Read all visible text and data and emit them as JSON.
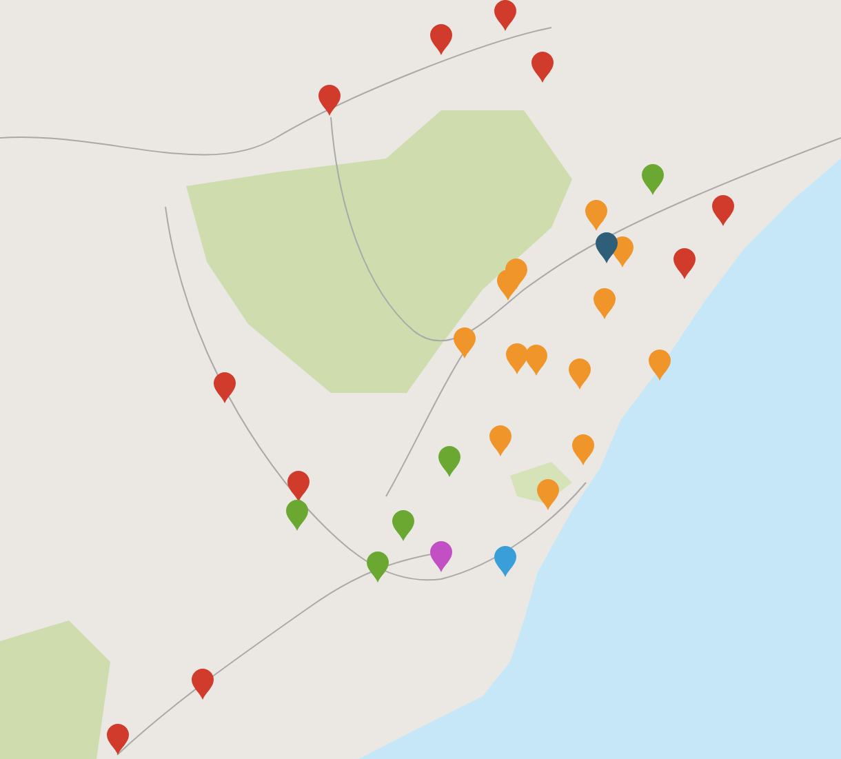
{
  "map": {
    "markers": [
      {
        "color": "#d13b2b"
      },
      {
        "color": "#d13b2b"
      },
      {
        "color": "#d13b2b"
      },
      {
        "color": "#d13b2b"
      },
      {
        "color": "#d13b2b"
      },
      {
        "color": "#d13b2b"
      },
      {
        "color": "#d13b2b"
      },
      {
        "color": "#d13b2b"
      },
      {
        "color": "#d13b2b"
      },
      {
        "color": "#d13b2b"
      },
      {
        "color": "#6aa832"
      },
      {
        "color": "#6aa832"
      },
      {
        "color": "#6aa832"
      },
      {
        "color": "#6aa832"
      },
      {
        "color": "#6aa832"
      },
      {
        "color": "#f0952a"
      },
      {
        "color": "#f0952a"
      },
      {
        "color": "#f0952a"
      },
      {
        "color": "#f0952a"
      },
      {
        "color": "#f0952a"
      },
      {
        "color": "#f0952a"
      },
      {
        "color": "#f0952a"
      },
      {
        "color": "#f0952a"
      },
      {
        "color": "#f0952a"
      },
      {
        "color": "#f0952a"
      },
      {
        "color": "#f0952a"
      },
      {
        "color": "#f0952a"
      },
      {
        "color": "#f0952a"
      },
      {
        "color": "#2f5f78"
      },
      {
        "color": "#c24fc4"
      },
      {
        "color": "#3a9fd8"
      }
    ]
  }
}
